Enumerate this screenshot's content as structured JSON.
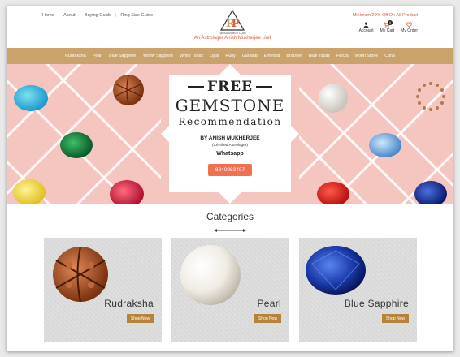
{
  "toplinks": [
    "Home",
    "About",
    "Buying Guide",
    "Ring Size Guide"
  ],
  "logo": {
    "site": "ratnapalace.com",
    "tagline": "An Astrologer Anish Mukherjee Unit"
  },
  "promo": "Minimum 20% Off On All Product",
  "account": {
    "account_label": "Account",
    "cart_label": "My Cart",
    "cart_count": "0",
    "order_label": "My Order"
  },
  "nav": [
    "Rudraksha",
    "Pearl",
    "Blue Sapphire",
    "Yellow Sapphire",
    "White Topaz",
    "Opal",
    "Ruby",
    "Garland",
    "Emerald",
    "Bracelet",
    "Blue Topaz",
    "Firoza",
    "Moon Stone",
    "Coral"
  ],
  "banner": {
    "free": "FREE",
    "gemstone": "GEMSTONE",
    "recommendation": "Recommendation",
    "by": "BY ANISH MUKHERJEE",
    "certified": "(Certified Astrologer)",
    "whatsapp": "Whatsapp",
    "phone": "8240983497"
  },
  "categories": {
    "title": "Categories",
    "items": [
      {
        "name": "Rudraksha",
        "button": "Shop Now"
      },
      {
        "name": "Pearl",
        "button": "Shop Now"
      },
      {
        "name": "Blue Sapphire",
        "button": "Shop Now"
      }
    ]
  },
  "colors": {
    "nav": "#c9a36a",
    "accent": "#e35d3a",
    "button": "#f07151",
    "shop": "#b5843a",
    "banner": "#f5c5c0"
  }
}
